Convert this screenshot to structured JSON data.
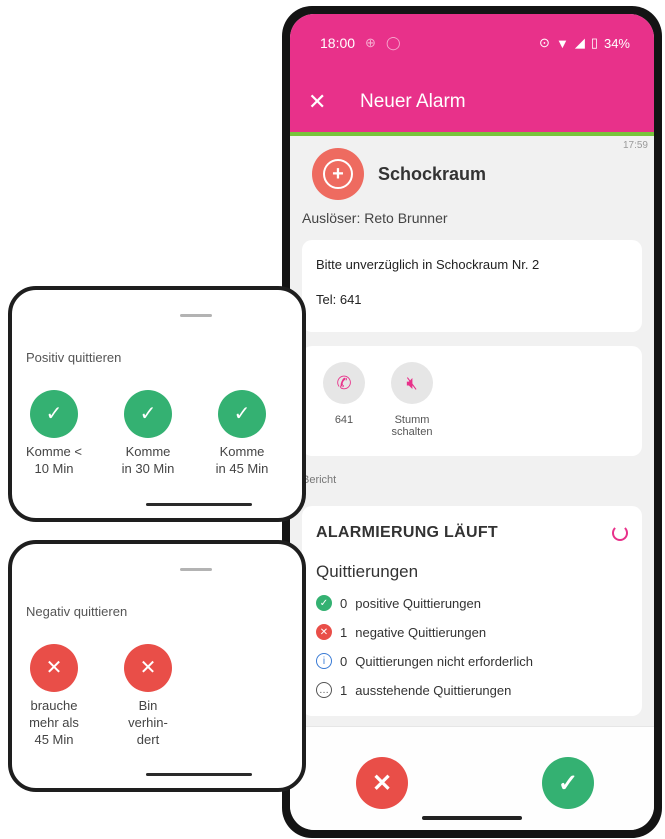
{
  "status_bar": {
    "time": "18:00",
    "battery": "34%"
  },
  "appbar": {
    "close_icon": "close-icon",
    "title": "Neuer Alarm"
  },
  "alarm": {
    "timestamp": "17:59",
    "category": "Schockraum",
    "trigger": "Auslöser: Reto Brunner",
    "message_line1": "Bitte unverzüglich in Schockraum Nr. 2",
    "message_line2": "Tel: 641"
  },
  "actions": [
    {
      "label": "641",
      "icon": "phone-icon"
    },
    {
      "label": "Stumm schalten",
      "icon": "mute-icon"
    }
  ],
  "report": {
    "section_label": "Bericht",
    "status_title": "ALARMIERUNG LÄUFT",
    "subtitle": "Quittierungen",
    "rows": [
      {
        "count": "0",
        "label": "positive Quittierungen",
        "color": "#34b172"
      },
      {
        "count": "1",
        "label": "negative Quittierungen",
        "color": "#e94e48"
      },
      {
        "count": "0",
        "label": "Quittierungen nicht erforderlich",
        "color": "#3a7bd5"
      },
      {
        "count": "1",
        "label": "ausstehende Quittierungen",
        "color": "#555555"
      }
    ]
  },
  "positive_popup": {
    "title": "Positiv quittieren",
    "buttons": [
      "Komme < 10 Min",
      "Komme in 30 Min",
      "Komme in 45 Min"
    ]
  },
  "negative_popup": {
    "title": "Negativ quittieren",
    "buttons": [
      "brauche mehr als 45 Min",
      "Bin verhin-dert"
    ]
  },
  "colors": {
    "brand": "#e8318a",
    "accent_green": "#78c43c",
    "positive": "#34b172",
    "negative": "#e94e48"
  }
}
